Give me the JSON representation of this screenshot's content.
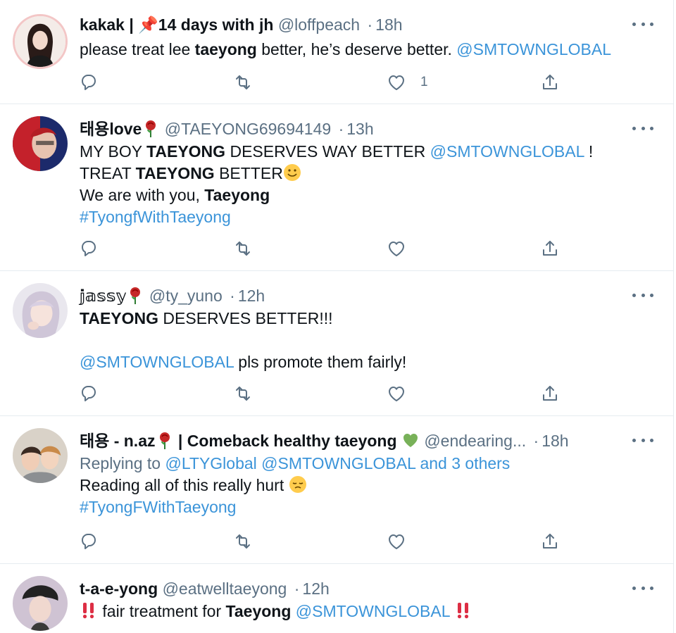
{
  "colors": {
    "link": "#3b94d9",
    "muted": "#5b7083",
    "text": "#0f1419",
    "divider": "#e6ecf0"
  },
  "icons": [
    "reply-icon",
    "retweet-icon",
    "like-icon",
    "share-icon",
    "more-icon"
  ],
  "tweets": [
    {
      "name": "kakak | 📌14 days with jh",
      "handle": "@loffpeach",
      "dot": "·",
      "time": "18h",
      "body": {
        "l1a": "please treat lee ",
        "l1b": "taeyong",
        "l1c": " better, he’s deserve better. ",
        "l1d": "@SMTOWNGLOBAL"
      },
      "likes": "1"
    },
    {
      "name": "태용love",
      "handle": "@TAEYONG69694149",
      "dot": "·",
      "time": "13h",
      "body": {
        "l1a": "MY BOY ",
        "l1b": "TAEYONG",
        "l1c": " DESERVES WAY BETTER ",
        "l1d": "@SMTOWNGLOBAL",
        "l1e": " !",
        "l2a": "TREAT ",
        "l2b": "TAEYONG",
        "l2c": " BETTER",
        "l3a": "We are with you, ",
        "l3b": "Taeyong",
        "l4": "#TyongfWithTaeyong"
      }
    },
    {
      "name": "𝕛𝕒𝕤𝕤𝕪",
      "handle": "@ty_yuno",
      "dot": "·",
      "time": "12h",
      "body": {
        "l1a": "TAEYONG",
        "l1b": " DESERVES BETTER!!!",
        "l3a": "@SMTOWNGLOBAL",
        "l3b": " pls promote them fairly!"
      }
    },
    {
      "name": "태용 - n.az",
      "name2": " | Comeback healthy taeyong ",
      "handle": "@endearing...",
      "dot": "·",
      "time": "18h",
      "body": {
        "reply_prefix": "Replying to ",
        "reply_users": "@LTYGlobal @SMTOWNGLOBAL and 3 others",
        "l2": "Reading all of this really hurt ",
        "l3": "#TyongFWithTaeyong"
      }
    },
    {
      "name": "t-a-e-yong",
      "handle": "@eatwelltaeyong",
      "dot": "·",
      "time": "12h",
      "body": {
        "l1a": " fair treatment for ",
        "l1b": "Taeyong",
        "l1c": " ",
        "l1d": "@SMTOWNGLOBAL"
      }
    }
  ]
}
